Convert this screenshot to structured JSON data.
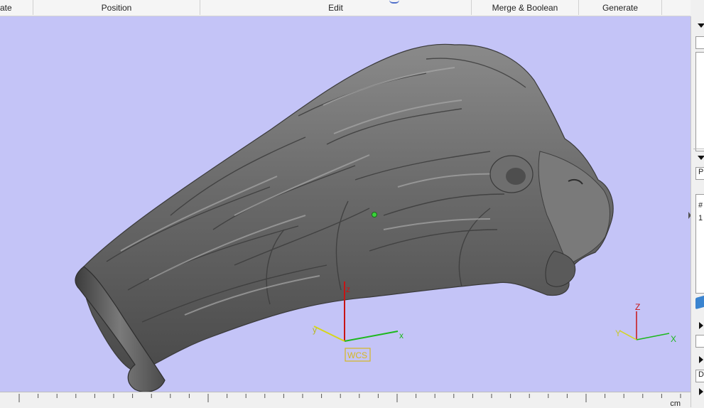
{
  "menu": {
    "items": [
      {
        "label": "ate"
      },
      {
        "label": "Position"
      },
      {
        "label": "Edit"
      },
      {
        "label": "Merge & Boolean"
      },
      {
        "label": "Generate"
      }
    ]
  },
  "viewport": {
    "background_color": "#c4c4f7",
    "model_color": "#6c6c6c",
    "model": "lion-head-sculpt",
    "wcs": {
      "label": "WCS",
      "x_label": "x",
      "y_label": "y",
      "z_label": "z",
      "colors": {
        "x": "#1db81d",
        "y": "#d6d61a",
        "z": "#c81414"
      }
    },
    "triad": {
      "x_label": "X",
      "y_label": "Y",
      "z_label": "Z"
    }
  },
  "ruler": {
    "unit": "cm"
  },
  "side_panel": {
    "text_1": "P",
    "text_2": "#",
    "text_3": "1",
    "text_4": "D"
  }
}
